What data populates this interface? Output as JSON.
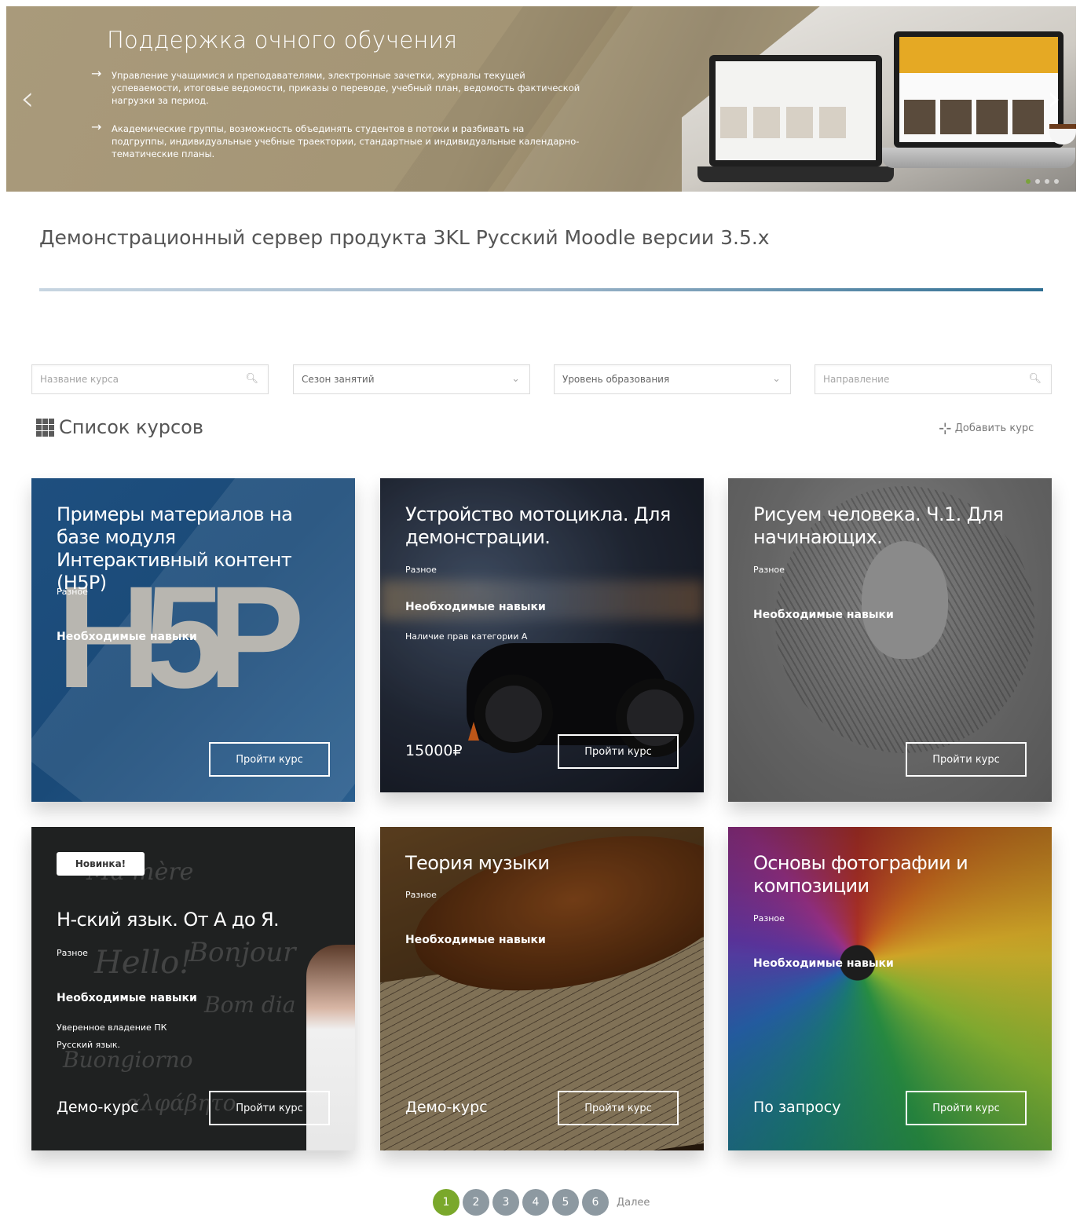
{
  "banner": {
    "title": "Поддержка очного обучения",
    "points": [
      "Управление учащимися и преподавателями, электронные зачетки, журналы текущей успеваемости, итоговые ведомости, приказы о переводе, учебный план, ведомость фактической нагрузки за период.",
      "Академические группы, возможность объединять студентов в потоки и разбивать на подгруппы, индивидуальные учебные траектории, стандартные и индивидуальные календарно-тематические планы."
    ],
    "prev_glyph": "‹",
    "next_glyph": "›"
  },
  "page_title": "Демонстрационный сервер продукта 3KL Русский Moodle версии 3.5.x",
  "filters": {
    "course_name_placeholder": "Название курса",
    "season": "Сезон занятий",
    "level": "Уровень образования",
    "direction_placeholder": "Направление"
  },
  "course_list": {
    "title": "Список курсов",
    "add_label": "Добавить курс"
  },
  "cards": [
    {
      "title": "Примеры материалов на базе модуля Интерактивный контент (H5P)",
      "category": "Разное",
      "skills_label": "Необходимые навыки",
      "logo_text": "H5P",
      "button": "Пройти курс"
    },
    {
      "title": "Устройство мотоцикла. Для демонстрации.",
      "category": "Разное",
      "skills_label": "Необходимые навыки",
      "skill_items": [
        "Наличие прав категории А"
      ],
      "price": "15000₽",
      "button": "Пройти курс"
    },
    {
      "title": "Рисуем человека. Ч.1. Для начинающих.",
      "category": "Разное",
      "skills_label": "Необходимые навыки",
      "button": "Пройти курс"
    },
    {
      "badge": "Новинка!",
      "title": "Н-ский язык. От А до Я.",
      "category": "Разное",
      "skills_label": "Необходимые навыки",
      "skill_items": [
        "Уверенное владение ПК",
        "Русский язык."
      ],
      "price": "Демо-курс",
      "button": "Пройти курс"
    },
    {
      "title": "Теория музыки",
      "category": "Разное",
      "skills_label": "Необходимые навыки",
      "price": "Демо-курс",
      "button": "Пройти курс"
    },
    {
      "title": "Основы фотографии и композиции",
      "category": "Разное",
      "skills_label": "Необходимые навыки",
      "price": "По запросу",
      "button": "Пройти курс"
    }
  ],
  "pagination": {
    "pages": [
      "1",
      "2",
      "3",
      "4",
      "5",
      "6"
    ],
    "active": "1",
    "next_label": "Далее"
  },
  "colors": {
    "banner_bg": "#a99a7b",
    "pagination_active": "#7aa82b",
    "pagination_inactive": "#8d99a1",
    "h5p_card": "#1e4f7f",
    "divider_accent": "#2f6f93"
  },
  "icons": {
    "search": "search-icon",
    "dropdown": "chevron-down-icon",
    "grid": "grid-icon",
    "add": "add-icon"
  }
}
